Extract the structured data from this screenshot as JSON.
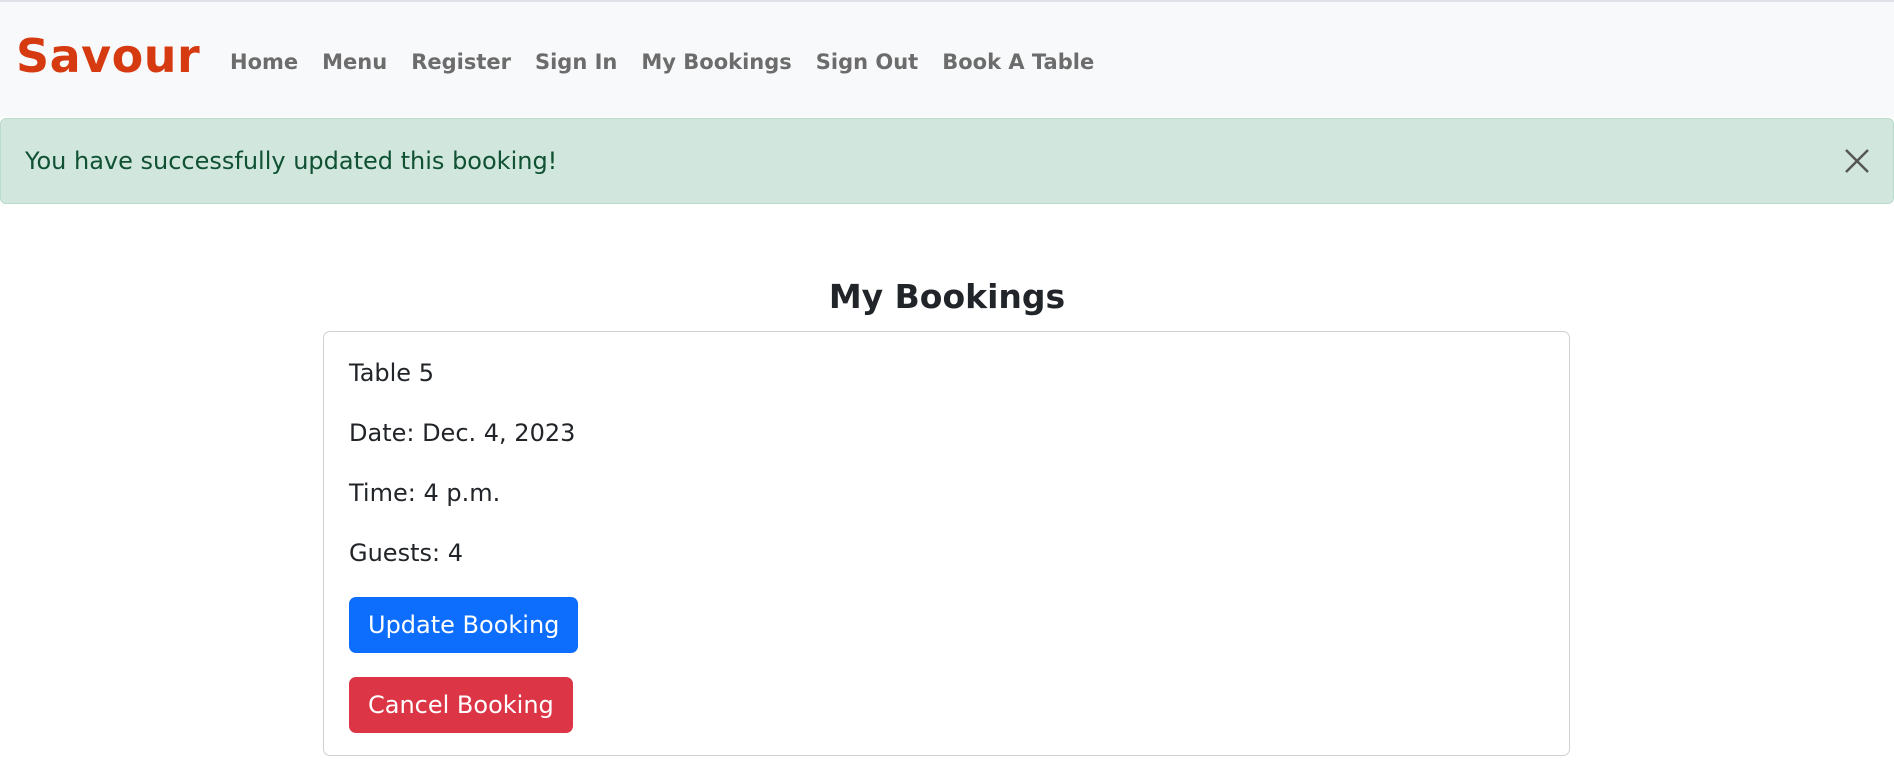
{
  "brand": {
    "name": "Savour",
    "color": "#d63a10"
  },
  "nav": {
    "items": [
      {
        "label": "Home"
      },
      {
        "label": "Menu"
      },
      {
        "label": "Register"
      },
      {
        "label": "Sign In"
      },
      {
        "label": "My Bookings"
      },
      {
        "label": "Sign Out"
      },
      {
        "label": "Book A Table"
      }
    ]
  },
  "alert": {
    "message": "You have successfully updated this booking!",
    "close_icon": "close-icon",
    "background": "#d1e7dd",
    "text_color": "#0f5132"
  },
  "main": {
    "title": "My Bookings",
    "booking": {
      "table": "Table 5",
      "date": "Date: Dec. 4, 2023",
      "time": "Time: 4 p.m.",
      "guests": "Guests: 4",
      "update_label": "Update Booking",
      "cancel_label": "Cancel Booking",
      "update_color": "#0d6efd",
      "cancel_color": "#dc3545"
    }
  }
}
